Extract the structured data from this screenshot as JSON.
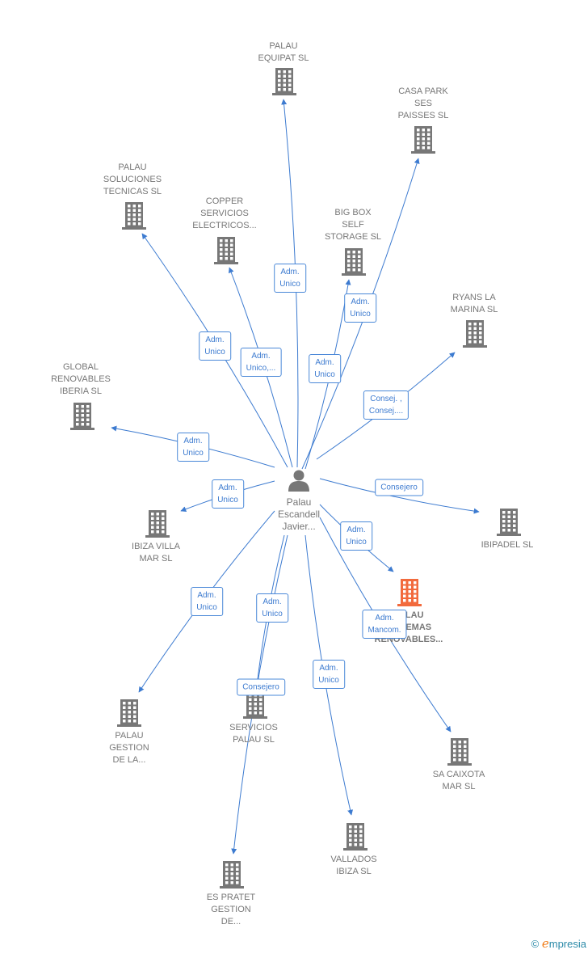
{
  "center": {
    "name": "Palau\nEscandell\nJavier...",
    "icon": "person-icon"
  },
  "colors": {
    "edge": "#3d7bd0",
    "building": "#777777",
    "highlight": "#f26a3d"
  },
  "nodes": [
    {
      "label": "PALAU\nEQUIPAT SL",
      "edge_label": "Adm.\nUnico"
    },
    {
      "label": "CASA PARK\nSES\nPAISSES SL",
      "edge_label": "Adm.\nUnico"
    },
    {
      "label": "PALAU\nSOLUCIONES\nTECNICAS SL",
      "edge_label": "Adm.\nUnico"
    },
    {
      "label": "COPPER\nSERVICIOS\nELECTRICOS...",
      "edge_label": "Adm.\nUnico,..."
    },
    {
      "label": "BIG BOX\nSELF\nSTORAGE SL",
      "edge_label": "Adm.\nUnico"
    },
    {
      "label": "RYANS LA\nMARINA SL",
      "edge_label": "Consej. ,\nConsej...."
    },
    {
      "label": "GLOBAL\nRENOVABLES\nIBERIA SL",
      "edge_label": "Adm.\nUnico"
    },
    {
      "label": "IBIZA VILLA\nMAR SL",
      "edge_label": "Adm.\nUnico"
    },
    {
      "label": "IBIPADEL SL",
      "edge_label": "Consejero"
    },
    {
      "label": "PALAU\nSISTEMAS\nRENOVABLES...",
      "edge_label": "Adm.\nUnico",
      "highlight": true
    },
    {
      "label": "PALAU\nGESTION\nDE LA...",
      "edge_label": "Adm.\nUnico"
    },
    {
      "label": "SERVICIOS\nPALAU SL",
      "edge_label": "Consejero"
    },
    {
      "label": "SA CAIXOTA\nMAR SL",
      "edge_label": "Adm.\nMancom."
    },
    {
      "label": "VALLADOS\nIBIZA SL",
      "edge_label": "Adm.\nUnico"
    },
    {
      "label": "ES PRATET\nGESTION\nDE...",
      "edge_label": "Adm.\nUnico"
    }
  ],
  "footer": {
    "copyright": "©",
    "brand": "mpresia",
    "brand_initial": "e"
  }
}
